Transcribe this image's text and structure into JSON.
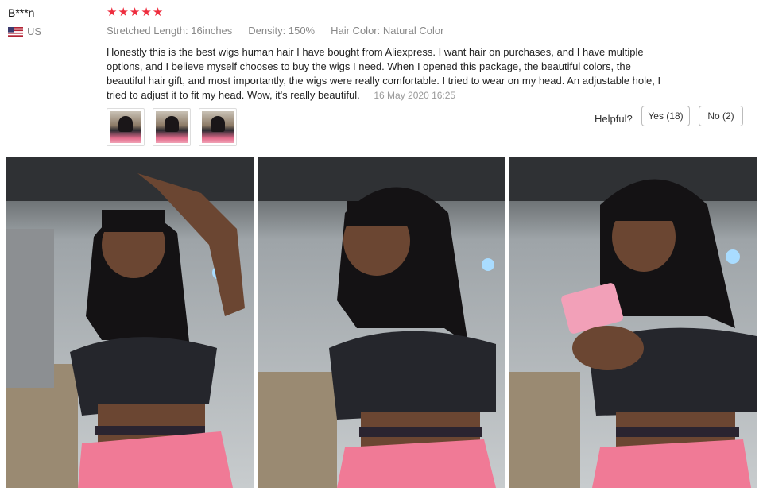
{
  "reviewer": {
    "name": "B***n",
    "country": "US"
  },
  "rating": {
    "stars": 5,
    "star_glyph": "★"
  },
  "attributes": [
    "Stretched Length: 16inches",
    "Density: 150%",
    "Hair Color: Natural Color"
  ],
  "review": {
    "text": "Honestly this is the best wigs human hair I have bought from Aliexpress. I want hair on purchases, and I have multiple options, and I believe myself chooses to buy the wigs I need. When I opened this package, the beautiful colors, the beautiful hair gift, and most importantly, the wigs were really comfortable. I tried to wear on my head. An adjustable hole, I tried to adjust it to fit my head. Wow, it's really beautiful.",
    "date": "16 May 2020 16:25"
  },
  "feedback": {
    "prompt": "Helpful?",
    "yes_label": "Yes (18)",
    "no_label": "No (2)"
  },
  "colors": {
    "star": "#ee2e3f",
    "shirt": "#25262c",
    "shorts": "#f07a96",
    "hair": "#141214"
  }
}
